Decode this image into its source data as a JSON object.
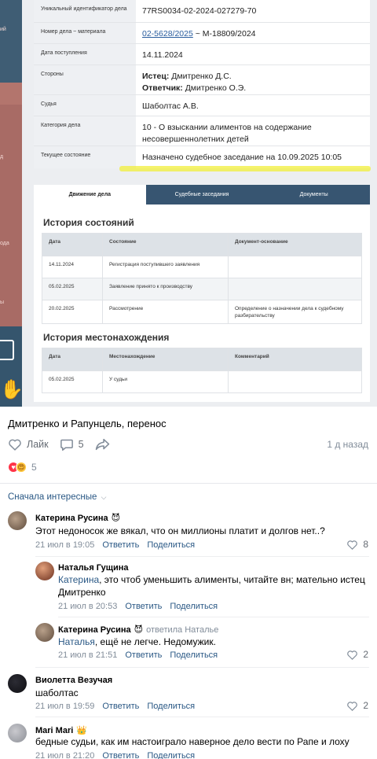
{
  "court_card": {
    "rows": [
      {
        "label": "Уникальный идентификатор дела",
        "value": "77RS0034-02-2024-027279-70"
      },
      {
        "label": "Номер дела ~ материала",
        "value_link": "02-5628/2025",
        "value_rest": " ~ М-18809/2024"
      },
      {
        "label": "Дата поступления",
        "value": "14.11.2024"
      },
      {
        "label": "Стороны",
        "plaintiff_label": "Истец:",
        "plaintiff": " Дмитренко Д.С.",
        "defendant_label": "Ответчик:",
        "defendant": " Дмитренко О.Э."
      },
      {
        "label": "Судья",
        "value": "Шаболтас А.В."
      },
      {
        "label": "Категория дела",
        "value": "10 - О взыскании алиментов на содержание несовершеннолетних детей"
      },
      {
        "label": "Текущее состояние",
        "value": "Назначено судебное заседание на 10.09.2025 10:05"
      }
    ],
    "tabs": [
      "Движение дела",
      "Судебные заседания",
      "Документы"
    ],
    "history_title": "История состояний",
    "history_headers": [
      "Дата",
      "Состояние",
      "Документ-основание"
    ],
    "history_rows": [
      [
        "14.11.2024",
        "Регистрация поступившего заявления",
        ""
      ],
      [
        "05.02.2025",
        "Заявление принято к производству",
        ""
      ],
      [
        "20.02.2025",
        "Рассмотрение",
        "Определение о назначении дела к судебному разбирательству"
      ]
    ],
    "location_title": "История местонахождения",
    "location_headers": [
      "Дата",
      "Местонахождение",
      "Комментарий"
    ],
    "location_rows": [
      [
        "05.02.2025",
        "У судьи",
        ""
      ]
    ],
    "sidebar_fragments": [
      "ий",
      "д",
      "ода",
      "ы"
    ]
  },
  "post": {
    "text": "Дмитренко и Рапунцель, перенос",
    "like_label": "Лайк",
    "comments_count": "5",
    "time": "1 д назад",
    "reactions_count": "5"
  },
  "sort_label": "Сначала интересные",
  "comments": [
    {
      "name": "Катерина Русина",
      "badge": "😈",
      "text": "Этот недоносок же вякал, что он миллионы платит и долгов нет..?",
      "time": "21 июл в 19:05",
      "reply": "Ответить",
      "share": "Поделиться",
      "likes": "8"
    },
    {
      "name": "Наталья Гущина",
      "addr": "Катерина",
      "text": ", это чтоб уменьшить алименты, читайте вн; мательно истец Дмитренко",
      "time": "21 июл в 20:53",
      "reply": "Ответить",
      "share": "Поделиться",
      "likes": ""
    },
    {
      "name": "Катерина Русина",
      "badge": "😈",
      "reply_to": "ответила Наталье",
      "addr": "Наталья",
      "text": ", ещё не легче. Недомужик.",
      "time": "21 июл в 21:51",
      "reply": "Ответить",
      "share": "Поделиться",
      "likes": "2"
    },
    {
      "name": "Виолетта Везучая",
      "text": "шаболтас",
      "time": "21 июл в 19:59",
      "reply": "Ответить",
      "share": "Поделиться",
      "likes": "2"
    },
    {
      "name": "Mari Mari",
      "badge": "👑",
      "text": "бедные судьи, как им настоиграло наверное дело вести по Рапе и лоху",
      "time": "21 июл в 21:20",
      "reply": "Ответить",
      "share": "Поделиться",
      "likes": ""
    }
  ],
  "colors": {
    "link": "#2a5885",
    "muted": "#818c99",
    "heart": "#ff3347",
    "table_tab": "#375571"
  }
}
